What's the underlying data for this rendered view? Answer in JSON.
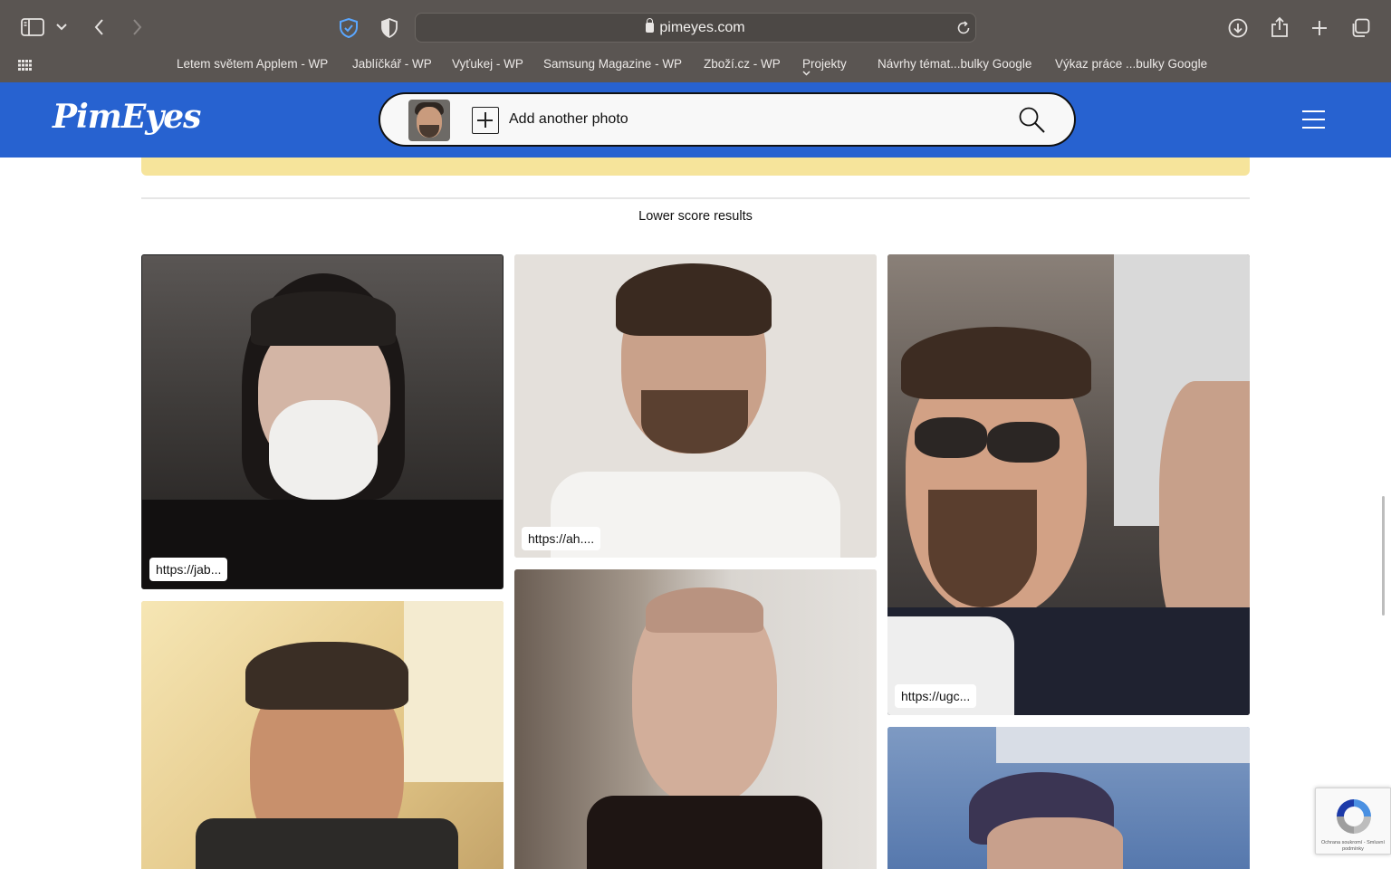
{
  "browser": {
    "url": "pimeyes.com",
    "bookmarks": [
      "Letem světem Applem - WP",
      "Jablíčkář - WP",
      "Vyťukej - WP",
      "Samsung Magazine - WP",
      "Zboží.cz - WP",
      "Projekty",
      "Návrhy témat...bulky Google",
      "Výkaz práce ...bulky Google"
    ]
  },
  "header": {
    "logo": "PimEyes",
    "add_photo_label": "Add another photo",
    "brand_color": "#2762d0"
  },
  "page": {
    "section_title": "Lower score results",
    "results": [
      {
        "url": "https://jab..."
      },
      {
        "url": "https://ah...."
      },
      {
        "url": "https://ugc..."
      }
    ]
  },
  "recaptcha": {
    "text": "Ochrana soukromí - Smluvní podmínky"
  },
  "icons": [
    "sidebar-icon",
    "chevron-down-icon",
    "back-icon",
    "forward-icon",
    "shield-check-icon",
    "privacy-shield-icon",
    "lock-icon",
    "reload-icon",
    "download-icon",
    "share-icon",
    "new-tab-icon",
    "tabs-overview-icon",
    "apps-grid-icon",
    "search-icon",
    "menu-icon",
    "recaptcha-icon"
  ]
}
